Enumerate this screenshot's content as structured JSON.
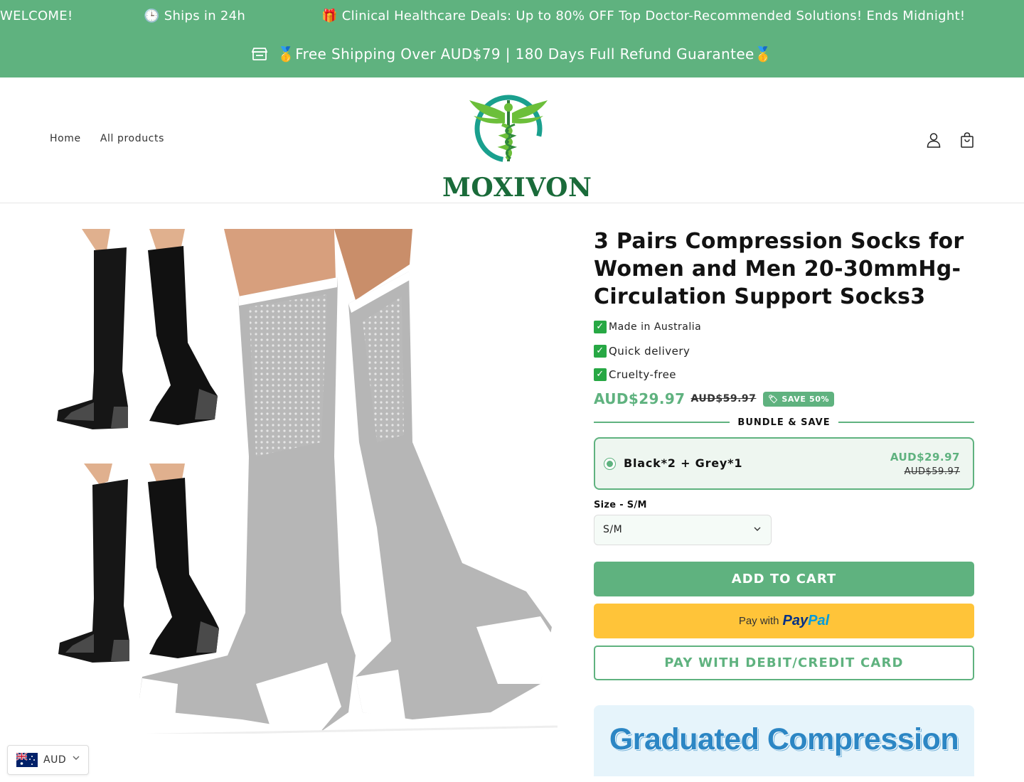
{
  "announcement": {
    "welcome": "WELCOME!",
    "ships": "🕒 Ships in 24h",
    "deals": "🎁 Clinical Healthcare Deals: Up to 80% OFF Top Doctor-Recommended Solutions! Ends Midnight!",
    "shipping": "🥇Free Shipping Over AUD$79 | 180 Days Full Refund Guarantee🥇",
    "background": "#5fb27f"
  },
  "header": {
    "nav": [
      "Home",
      "All products"
    ],
    "logo_text": "MOXIVON",
    "icons": [
      "account-icon",
      "cart-icon"
    ]
  },
  "product": {
    "title": "3 Pairs Compression Socks for Women and Men 20-30mmHg-Circulation Support Socks3",
    "features": [
      "Made in Australia",
      "Quick delivery",
      "Cruelty-free"
    ],
    "price": "AUD$29.97",
    "compare_price": "AUD$59.97",
    "save_badge": "SAVE 50%",
    "bundle_heading": "BUNDLE & SAVE",
    "bundle": {
      "label": "Black*2 + Grey*1",
      "price": "AUD$29.97",
      "compare_price": "AUD$59.97",
      "selected": true
    },
    "size_label": "Size - S/M",
    "size_value": "S/M",
    "add_to_cart": "ADD TO CART",
    "paypal_prefix": "Pay with",
    "paypal_word_1": "Pay",
    "paypal_word_2": "Pal",
    "card_button": "PAY WITH DEBIT/CREDIT CARD",
    "promo_text": "Graduated Compression"
  },
  "currency": {
    "code": "AUD",
    "flag": "australia-flag-icon"
  },
  "colors": {
    "accent": "#5fb27f",
    "paypal": "#ffc439",
    "logo_green": "#1a6b3a"
  }
}
